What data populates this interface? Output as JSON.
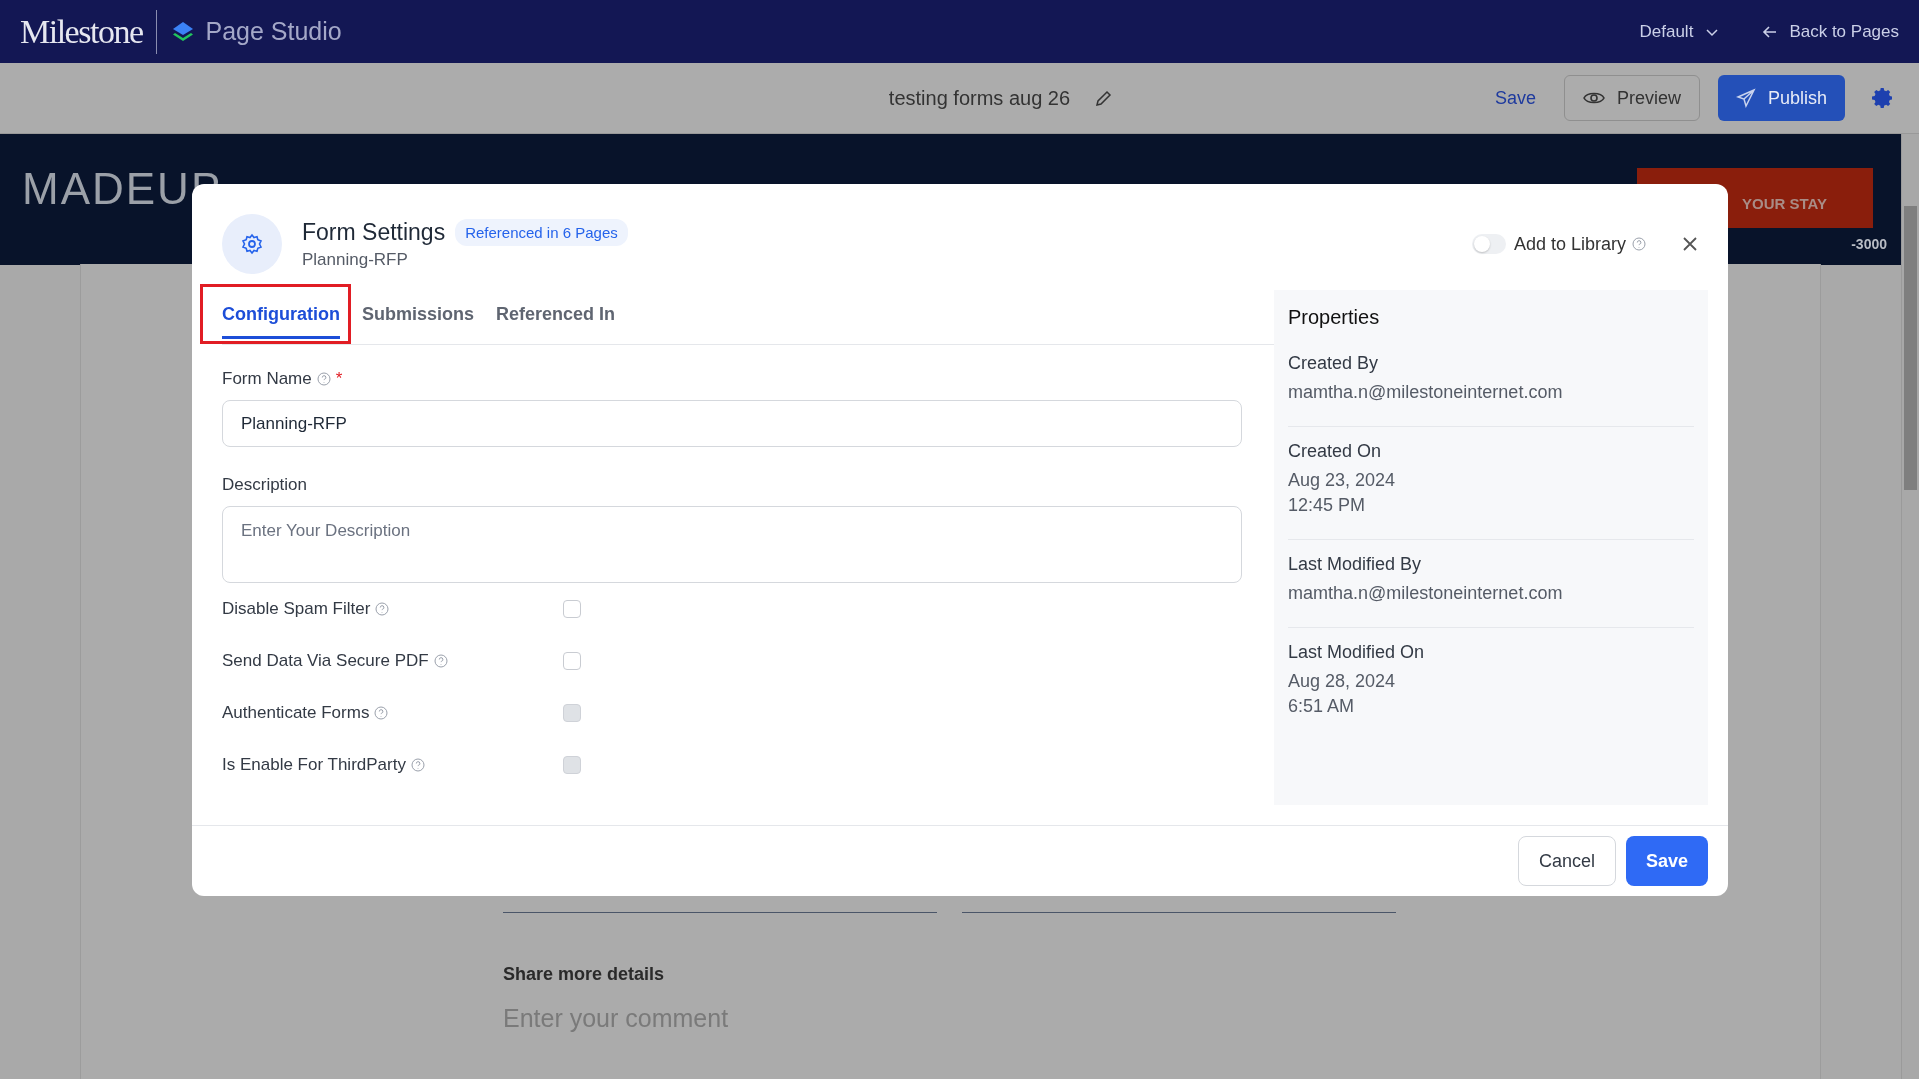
{
  "app_bar": {
    "logo": "Milestone",
    "product": "Page Studio",
    "theme": "Default",
    "back_link": "Back to Pages"
  },
  "toolbar": {
    "page_title": "testing forms aug 26",
    "save": "Save",
    "preview": "Preview",
    "publish": "Publish"
  },
  "background_page": {
    "brand": "MADEUP",
    "cta": "YOUR STAY",
    "phone": "-3000",
    "comment_label": "Share more details",
    "comment_placeholder": "Enter your comment"
  },
  "dialog": {
    "title": "Form Settings",
    "badge": "Referenced in 6 Pages",
    "subtitle": "Planning-RFP",
    "add_to_library": {
      "label": "Add to Library",
      "on": false
    },
    "tabs": [
      {
        "label": "Configuration",
        "selected": true,
        "highlighted": true
      },
      {
        "label": "Submissions",
        "selected": false,
        "highlighted": false
      },
      {
        "label": "Referenced In",
        "selected": false,
        "highlighted": false
      }
    ],
    "form_name": {
      "label": "Form Name",
      "required": true,
      "required_mark": "*",
      "value": "Planning-RFP"
    },
    "description": {
      "label": "Description",
      "placeholder": "Enter Your Description"
    },
    "options": [
      {
        "label": "Disable Spam Filter",
        "checked": false,
        "disabled": false
      },
      {
        "label": "Send Data Via Secure PDF",
        "checked": false,
        "disabled": false
      },
      {
        "label": "Authenticate Forms",
        "checked": false,
        "disabled": true
      },
      {
        "label": "Is Enable For ThirdParty",
        "checked": false,
        "disabled": true
      }
    ],
    "properties": {
      "title": "Properties",
      "items": [
        {
          "label": "Created By",
          "lines": [
            "mamtha.n@milestoneinternet.com"
          ]
        },
        {
          "label": "Created On",
          "lines": [
            "Aug 23, 2024",
            "12:45 PM"
          ]
        },
        {
          "label": "Last Modified By",
          "lines": [
            "mamtha.n@milestoneinternet.com"
          ]
        },
        {
          "label": "Last Modified On",
          "lines": [
            "Aug 28, 2024",
            "6:51 AM"
          ]
        }
      ]
    },
    "buttons": {
      "cancel": "Cancel",
      "save": "Save"
    }
  }
}
